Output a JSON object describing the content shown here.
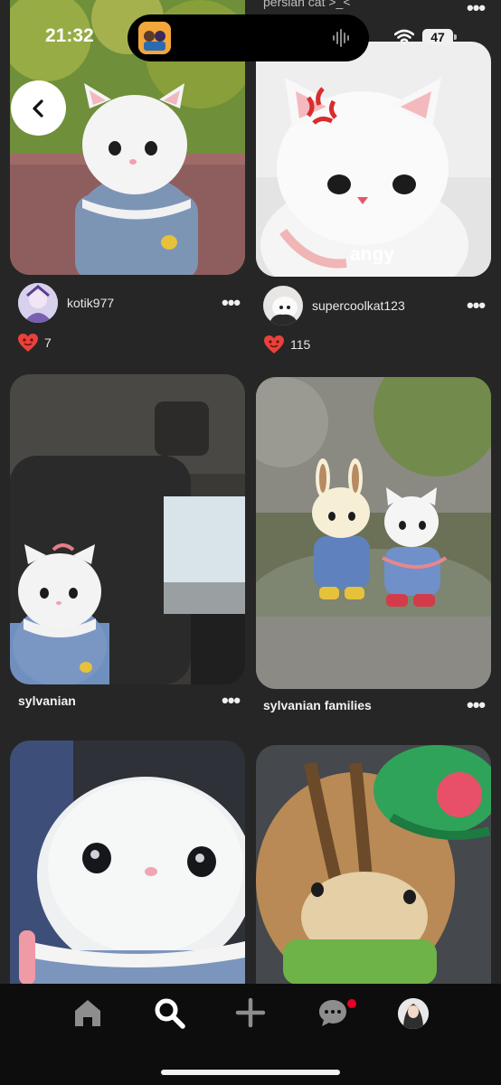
{
  "status_bar": {
    "time": "21:32",
    "battery": "47",
    "wifi_icon": "wifi-icon",
    "audio_icon": "audio-wave-icon"
  },
  "top_caption": "persian cat >_<",
  "back_button_icon": "chevron-left-icon",
  "pins": [
    {
      "id": "pin-1",
      "author": "kotik977",
      "likes": "7",
      "title": ""
    },
    {
      "id": "pin-2",
      "author": "supercoolkat123",
      "likes": "115",
      "overlay_text": "angy",
      "title": ""
    },
    {
      "id": "pin-3",
      "title": "sylvanian"
    },
    {
      "id": "pin-4",
      "title": "sylvanian families"
    },
    {
      "id": "pin-5",
      "title": ""
    },
    {
      "id": "pin-6",
      "title": ""
    }
  ],
  "more_icon": "more-horizontal-icon",
  "bottom_nav": {
    "items": [
      "home-icon",
      "search-icon",
      "plus-icon",
      "messages-icon",
      "profile-avatar"
    ],
    "active": "search-icon",
    "notification_dot_color": "#e60023"
  },
  "colors": {
    "background": "#262626",
    "heart": "#e8423a",
    "nav_background": "#0d0d0d"
  }
}
